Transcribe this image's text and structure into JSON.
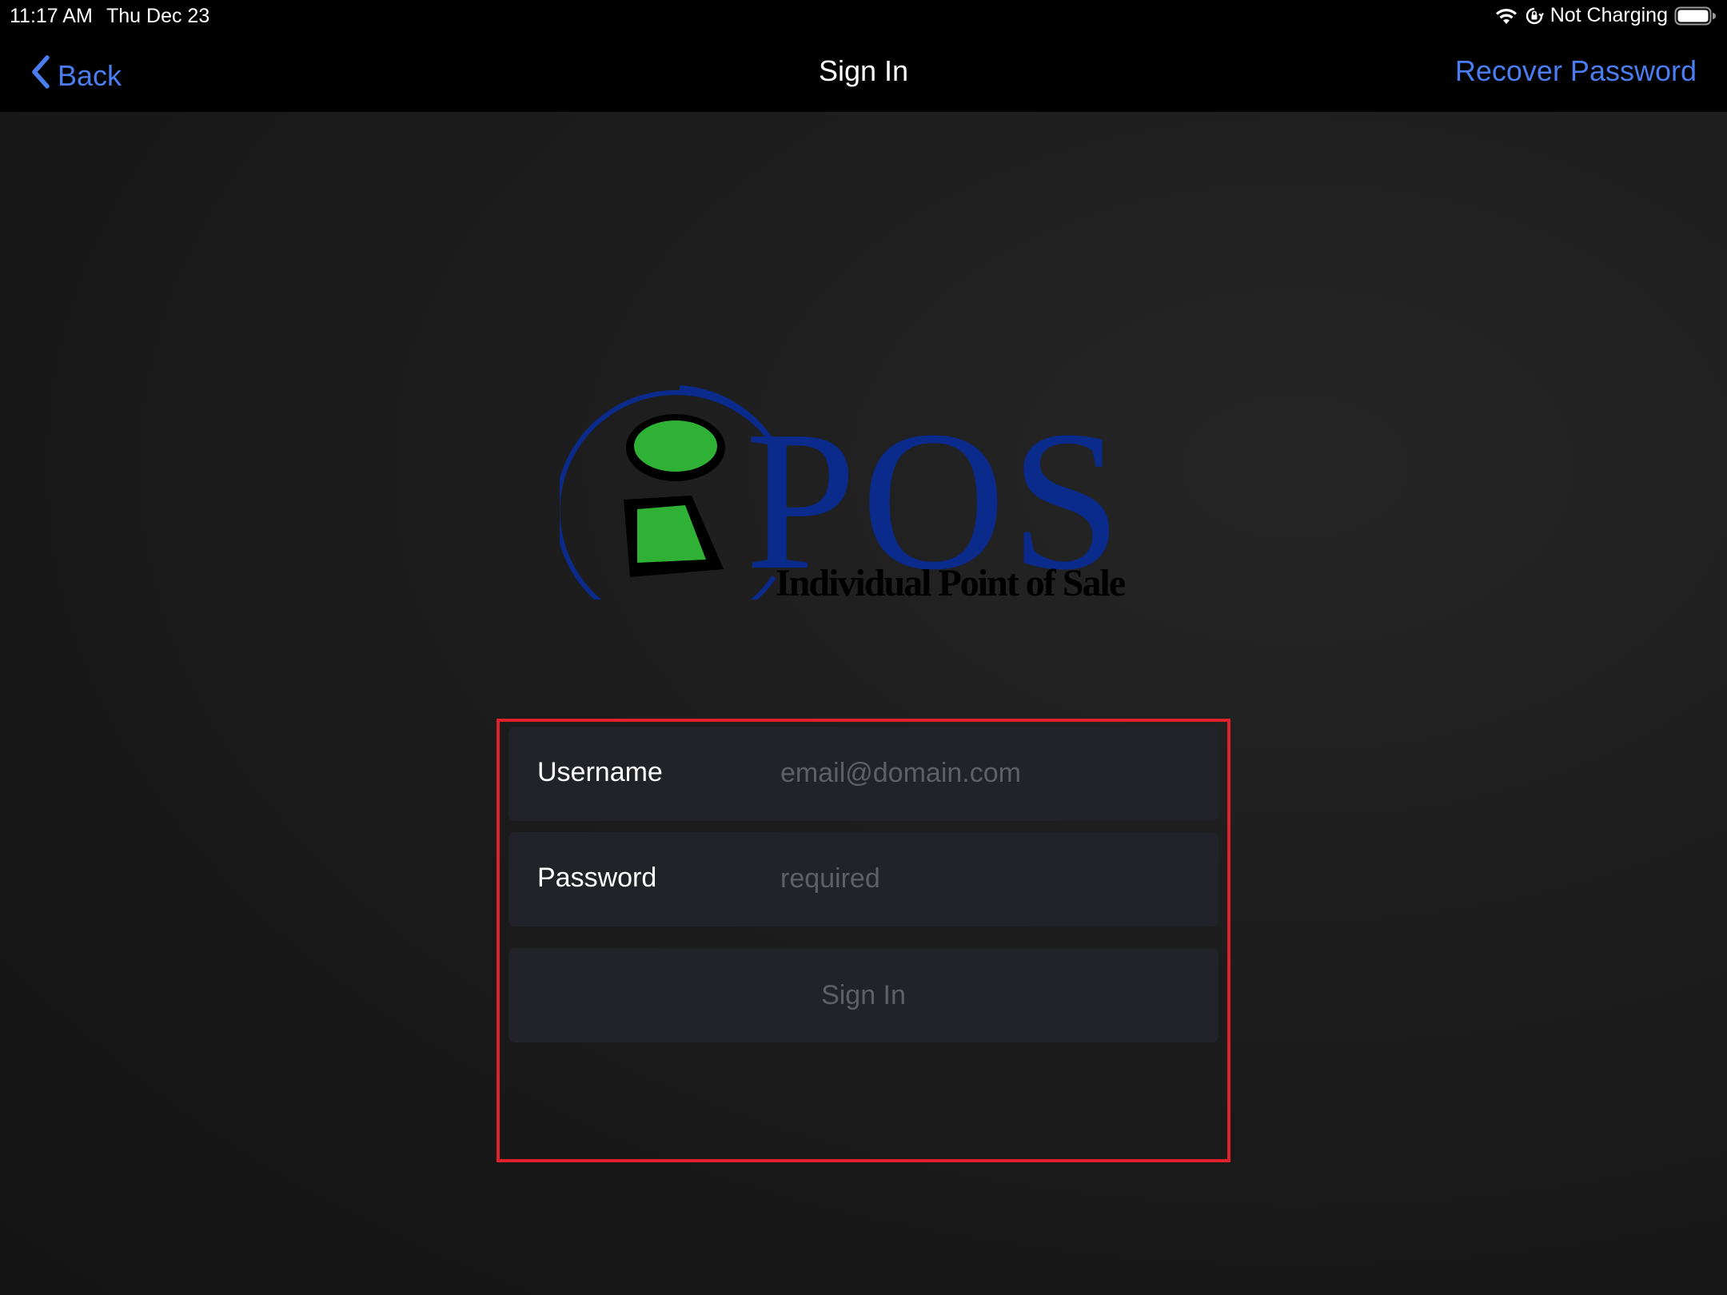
{
  "status_bar": {
    "time": "11:17 AM",
    "date": "Thu Dec 23",
    "battery_text": "Not Charging",
    "icons": [
      "wifi-icon",
      "orientation-lock-icon",
      "battery-icon"
    ]
  },
  "nav": {
    "back_label": "Back",
    "title": "Sign In",
    "recover_label": "Recover Password",
    "accent_color": "#4a7df0"
  },
  "logo": {
    "brand": "POS",
    "tagline": "Individual Point of Sale",
    "colors": {
      "ring": "#0a2a8c",
      "figure": "#2eb135",
      "text": "#0a2a8c"
    }
  },
  "form": {
    "username": {
      "label": "Username",
      "value": "",
      "placeholder": "email@domain.com"
    },
    "password": {
      "label": "Password",
      "value": "",
      "placeholder": "required"
    },
    "submit_label": "Sign In",
    "highlight_color": "#e0202a"
  }
}
